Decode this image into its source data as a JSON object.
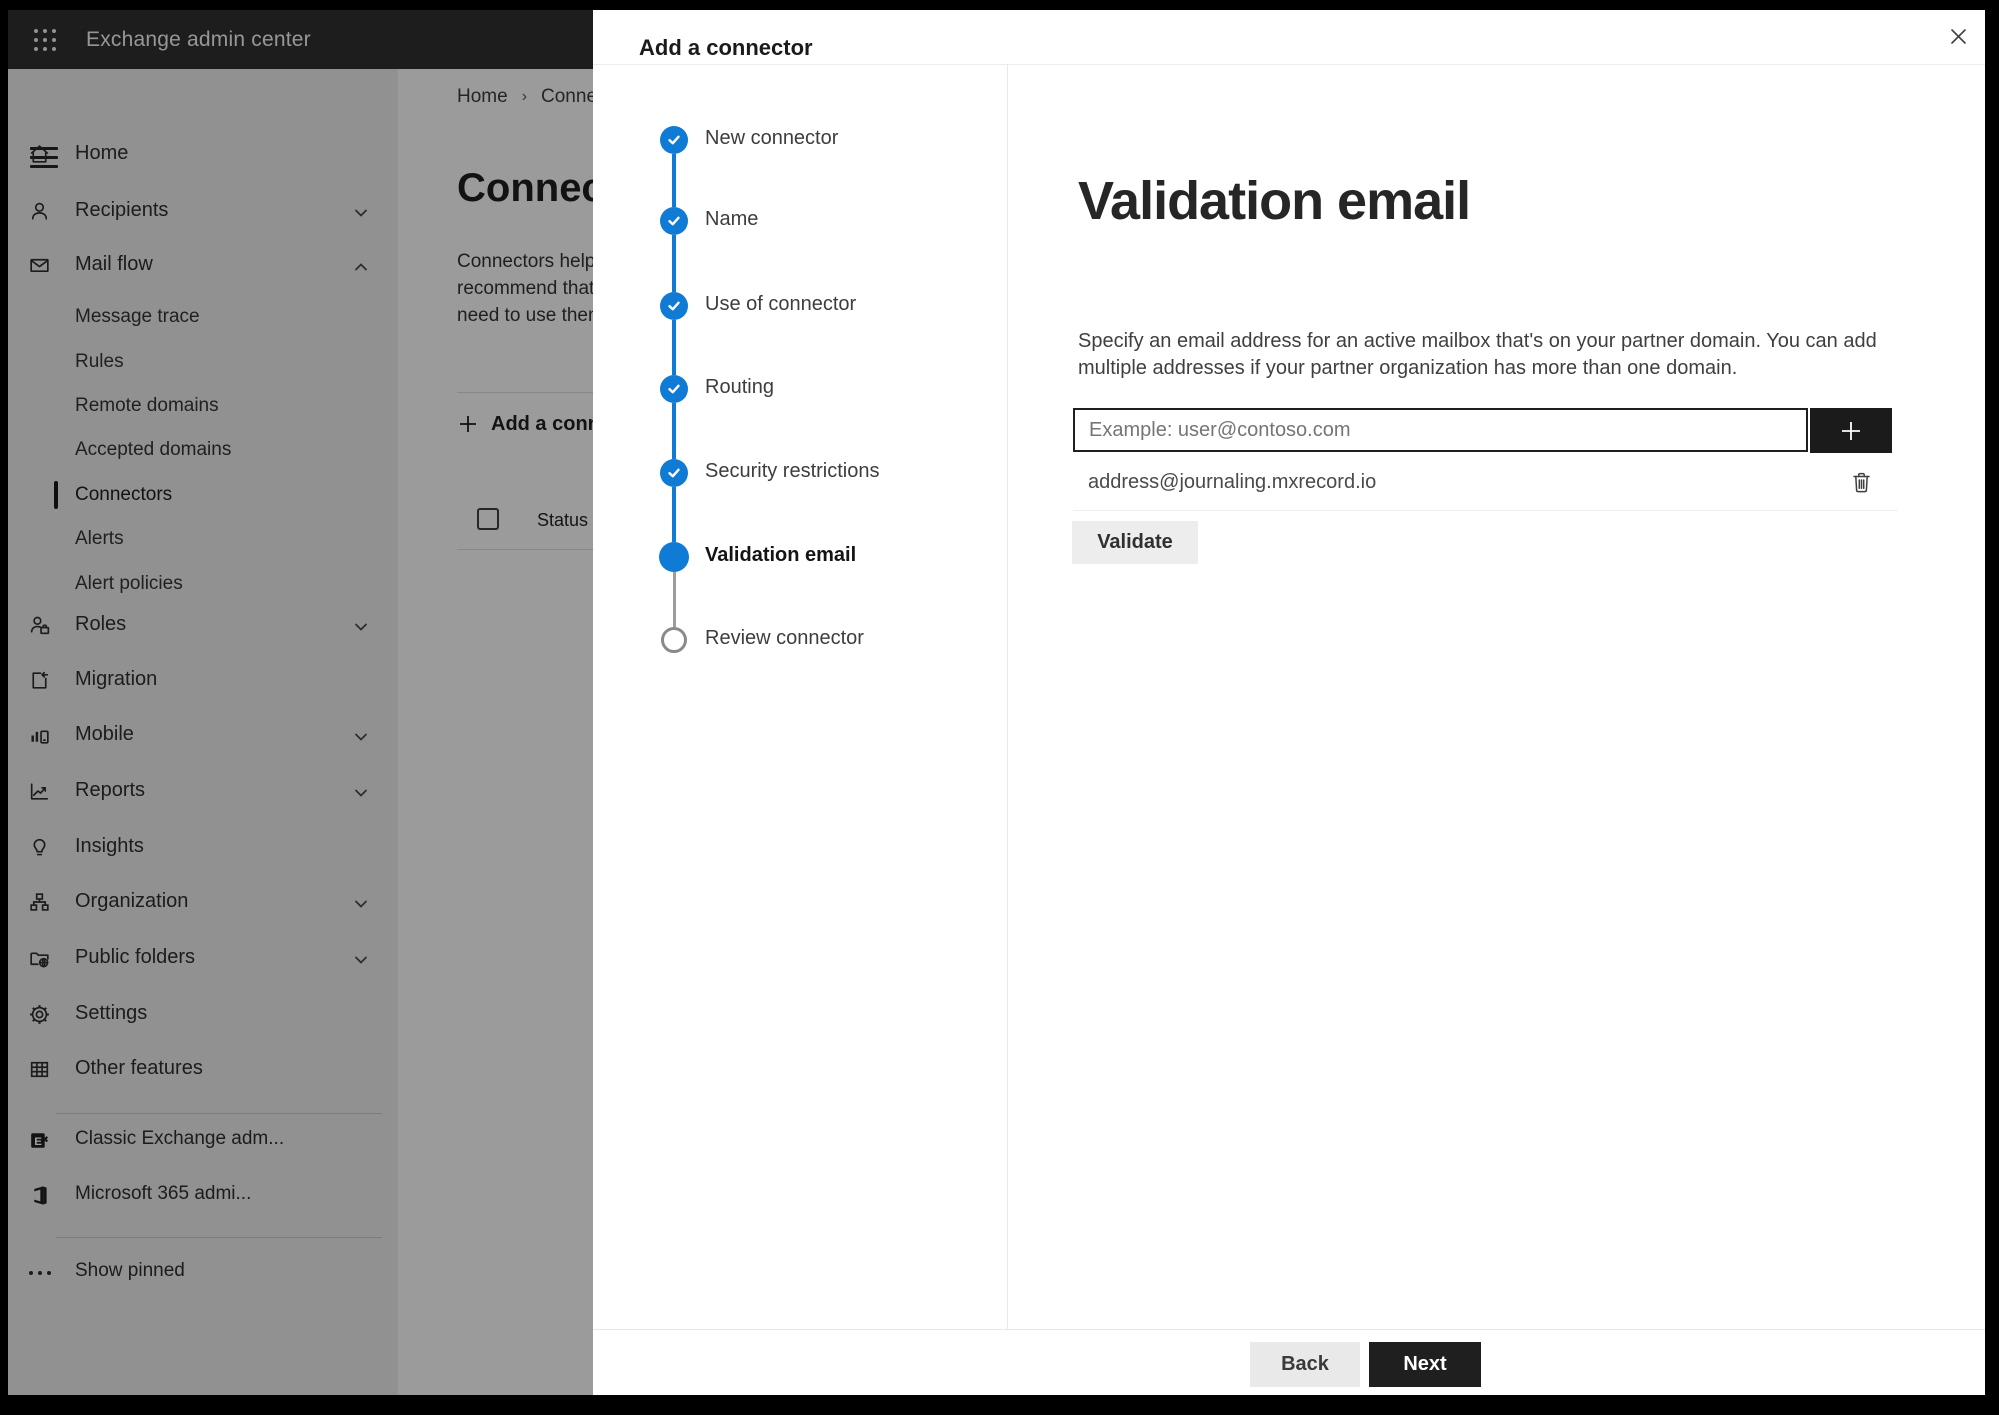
{
  "app": {
    "title": "Exchange admin center"
  },
  "colors": {
    "accent_blue": "#0f7bd4",
    "topbar_bg": "#2f2f2f",
    "dark_button": "#1f1f1f",
    "panel_bg": "#ffffff",
    "sidebar_bg": "#ebebeb",
    "dim_overlay": "rgba(0,0,0,0.38)"
  },
  "icons": {
    "app_launcher": "3x3 dot grid",
    "hamburger": "three horizontal lines",
    "close": "X",
    "check": "checkmark",
    "chevron_down": "v",
    "chevron_up": "^",
    "add": "+",
    "trash": "trash can outline",
    "ellipsis": "..."
  },
  "sidebar": {
    "home": "Home",
    "recipients": "Recipients",
    "mail_flow": "Mail flow",
    "mail_flow_children": [
      "Message trace",
      "Rules",
      "Remote domains",
      "Accepted domains",
      "Connectors",
      "Alerts",
      "Alert policies"
    ],
    "selected_item": "Connectors",
    "items_lower": [
      "Roles",
      "Migration",
      "Mobile",
      "Reports",
      "Insights",
      "Organization",
      "Public folders",
      "Settings",
      "Other features"
    ],
    "footer_items": [
      "Classic Exchange adm...",
      "Microsoft 365 admi..."
    ],
    "show_pinned": "Show pinned"
  },
  "background_page": {
    "breadcrumb": [
      "Home",
      "Connectors"
    ],
    "title": "Connectors",
    "intro_lines": [
      "Connectors help route mail messages",
      "recommend that you check whether a",
      "need to use them. If mail flow works"
    ],
    "add_button": "Add a connector",
    "status_column": "Status"
  },
  "panel": {
    "title": "Add a connector",
    "steps": [
      {
        "label": "New connector",
        "state": "completed"
      },
      {
        "label": "Name",
        "state": "completed"
      },
      {
        "label": "Use of connector",
        "state": "completed"
      },
      {
        "label": "Routing",
        "state": "completed"
      },
      {
        "label": "Security restrictions",
        "state": "completed"
      },
      {
        "label": "Validation email",
        "state": "current"
      },
      {
        "label": "Review connector",
        "state": "upcoming"
      }
    ],
    "heading": "Validation email",
    "description_line1": "Specify an email address for an active mailbox that's on your partner domain. You can add",
    "description_line2": "multiple addresses if your partner organization has more than one domain.",
    "email_placeholder": "Example: user@contoso.com",
    "email_value": "",
    "addresses": [
      "address@journaling.mxrecord.io"
    ],
    "validate_button": "Validate",
    "back_button": "Back",
    "next_button": "Next"
  }
}
